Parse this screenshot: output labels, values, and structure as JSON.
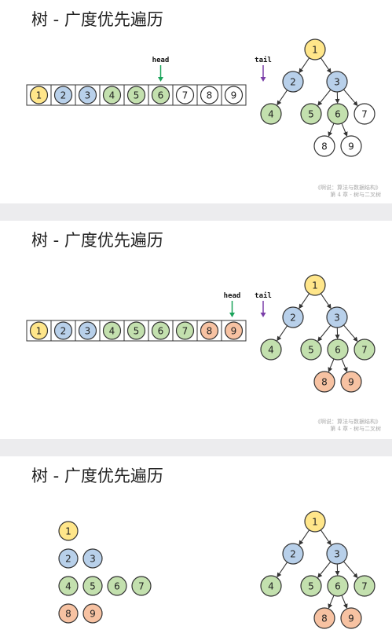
{
  "colors": {
    "yellow": "#ffe68a",
    "blue": "#b8d0ea",
    "green": "#c3e0ae",
    "orange": "#f7c2a2",
    "white": "#ffffff",
    "stroke": "#333333",
    "head_arrow": "#1aa35a",
    "tail_arrow": "#7a3ea8"
  },
  "tree": {
    "nodes": [
      {
        "label": "1",
        "parent": null
      },
      {
        "label": "2",
        "parent": "1"
      },
      {
        "label": "3",
        "parent": "1"
      },
      {
        "label": "4",
        "parent": "2"
      },
      {
        "label": "5",
        "parent": "3"
      },
      {
        "label": "6",
        "parent": "3"
      },
      {
        "label": "7",
        "parent": "3"
      },
      {
        "label": "8",
        "parent": "6"
      },
      {
        "label": "9",
        "parent": "6"
      }
    ]
  },
  "slides": [
    {
      "title": "树 - 广度优先遍历",
      "footer_line1": "《啊说：算法与数据结构》",
      "footer_line2": "第 4 章 - 树与二叉树",
      "head_label": "head",
      "tail_label": "tail",
      "head_index": 5,
      "queue": [
        {
          "label": "1",
          "color": "yellow"
        },
        {
          "label": "2",
          "color": "blue"
        },
        {
          "label": "3",
          "color": "blue"
        },
        {
          "label": "4",
          "color": "green"
        },
        {
          "label": "5",
          "color": "green"
        },
        {
          "label": "6",
          "color": "green"
        },
        {
          "label": "7",
          "color": "white"
        },
        {
          "label": "8",
          "color": "white"
        },
        {
          "label": "9",
          "color": "white"
        }
      ],
      "tree_colors": [
        "yellow",
        "blue",
        "blue",
        "green",
        "green",
        "green",
        "white",
        "white",
        "white"
      ]
    },
    {
      "title": "树 - 广度优先遍历",
      "footer_line1": "《啊说：算法与数据结构》",
      "footer_line2": "第 4 章 - 树与二叉树",
      "head_label": "head",
      "tail_label": "tail",
      "head_index": 8,
      "queue": [
        {
          "label": "1",
          "color": "yellow"
        },
        {
          "label": "2",
          "color": "blue"
        },
        {
          "label": "3",
          "color": "blue"
        },
        {
          "label": "4",
          "color": "green"
        },
        {
          "label": "5",
          "color": "green"
        },
        {
          "label": "6",
          "color": "green"
        },
        {
          "label": "7",
          "color": "green"
        },
        {
          "label": "8",
          "color": "orange"
        },
        {
          "label": "9",
          "color": "orange"
        }
      ],
      "tree_colors": [
        "yellow",
        "blue",
        "blue",
        "green",
        "green",
        "green",
        "green",
        "orange",
        "orange"
      ]
    },
    {
      "title": "树 - 广度优先遍历",
      "levels": [
        [
          {
            "label": "1",
            "color": "yellow"
          }
        ],
        [
          {
            "label": "2",
            "color": "blue"
          },
          {
            "label": "3",
            "color": "blue"
          }
        ],
        [
          {
            "label": "4",
            "color": "green"
          },
          {
            "label": "5",
            "color": "green"
          },
          {
            "label": "6",
            "color": "green"
          },
          {
            "label": "7",
            "color": "green"
          }
        ],
        [
          {
            "label": "8",
            "color": "orange"
          },
          {
            "label": "9",
            "color": "orange"
          }
        ]
      ],
      "tree_colors": [
        "yellow",
        "blue",
        "blue",
        "green",
        "green",
        "green",
        "green",
        "orange",
        "orange"
      ]
    }
  ]
}
